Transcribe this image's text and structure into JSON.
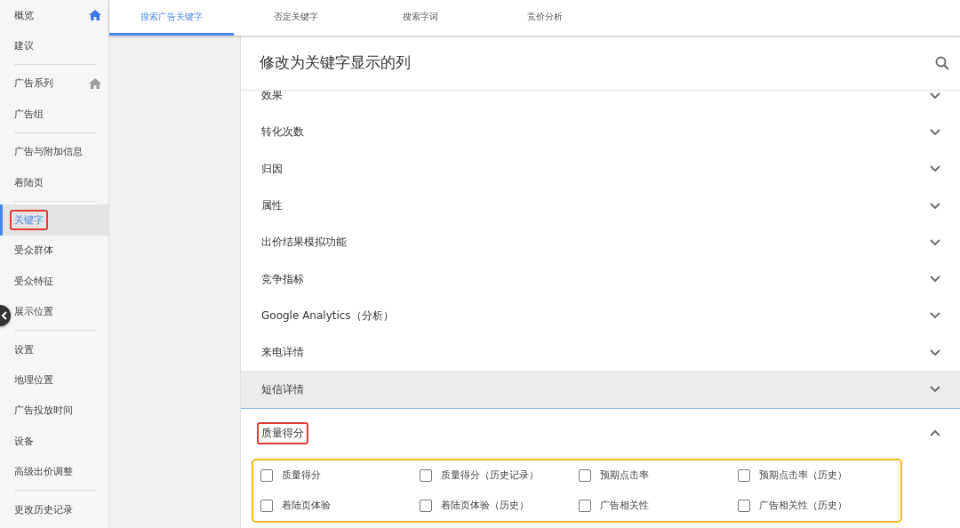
{
  "sidebar": {
    "groups": [
      {
        "items": [
          {
            "label": "概览",
            "selected": false,
            "marked": false,
            "home": {
              "highlighted": true
            }
          },
          {
            "label": "建议",
            "selected": false,
            "marked": false
          }
        ]
      },
      {
        "items": [
          {
            "label": "广告系列",
            "selected": false,
            "marked": false,
            "home": {
              "highlighted": false
            }
          },
          {
            "label": "广告组",
            "selected": false,
            "marked": false
          }
        ]
      },
      {
        "items": [
          {
            "label": "广告与附加信息",
            "selected": false,
            "marked": false
          },
          {
            "label": "着陆页",
            "selected": false,
            "marked": false
          }
        ]
      },
      {
        "items": [
          {
            "label": "关键字",
            "selected": true,
            "marked": true
          },
          {
            "label": "受众群体",
            "selected": false,
            "marked": false
          },
          {
            "label": "受众特征",
            "selected": false,
            "marked": false
          },
          {
            "label": "展示位置",
            "selected": false,
            "marked": false
          }
        ]
      },
      {
        "items": [
          {
            "label": "设置",
            "selected": false,
            "marked": false
          },
          {
            "label": "地理位置",
            "selected": false,
            "marked": false
          },
          {
            "label": "广告投放时间",
            "selected": false,
            "marked": false
          },
          {
            "label": "设备",
            "selected": false,
            "marked": false
          },
          {
            "label": "高级出价调整",
            "selected": false,
            "marked": false
          }
        ]
      },
      {
        "items": [
          {
            "label": "更改历史记录",
            "selected": false,
            "marked": false
          }
        ]
      }
    ]
  },
  "tabs": [
    {
      "label": "搜索广告关键字",
      "selected": true
    },
    {
      "label": "否定关键字",
      "selected": false
    },
    {
      "label": "搜索字词",
      "selected": false
    },
    {
      "label": "竞价分析",
      "selected": false
    }
  ],
  "panel": {
    "title": "修改为关键字显示的列",
    "sections": [
      {
        "label": "效果",
        "expanded": false,
        "highlighted": false,
        "marked": false
      },
      {
        "label": "转化次数",
        "expanded": false,
        "highlighted": false,
        "marked": false
      },
      {
        "label": "归因",
        "expanded": false,
        "highlighted": false,
        "marked": false
      },
      {
        "label": "属性",
        "expanded": false,
        "highlighted": false,
        "marked": false
      },
      {
        "label": "出价结果模拟功能",
        "expanded": false,
        "highlighted": false,
        "marked": false
      },
      {
        "label": "竞争指标",
        "expanded": false,
        "highlighted": false,
        "marked": false
      },
      {
        "label": "Google Analytics（分析）",
        "expanded": false,
        "highlighted": false,
        "marked": false
      },
      {
        "label": "来电详情",
        "expanded": false,
        "highlighted": false,
        "marked": false
      },
      {
        "label": "短信详情",
        "expanded": false,
        "highlighted": true,
        "marked": false
      },
      {
        "label": "质量得分",
        "expanded": true,
        "highlighted": false,
        "marked": true,
        "options_outlined": true,
        "options": [
          {
            "label": "质量得分",
            "checked": false
          },
          {
            "label": "质量得分（历史记录）",
            "checked": false
          },
          {
            "label": "预期点击率",
            "checked": false
          },
          {
            "label": "预期点击率（历史）",
            "checked": false
          },
          {
            "label": "着陆页体验",
            "checked": false
          },
          {
            "label": "着陆页体验（历史）",
            "checked": false
          },
          {
            "label": "广告相关性",
            "checked": false
          },
          {
            "label": "广告相关性（历史）",
            "checked": false
          }
        ]
      }
    ]
  }
}
